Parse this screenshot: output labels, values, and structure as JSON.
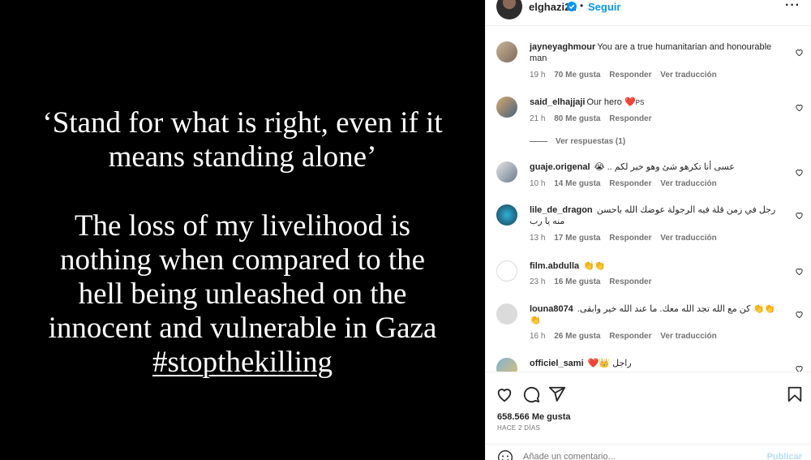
{
  "media": {
    "quote_lines_1": [
      "‘Stand for what is right, even if it",
      "means standing alone’"
    ],
    "quote_lines_2": [
      "The loss of my livelihood is",
      "nothing when compared to the",
      "hell being unleashed on the",
      "innocent and vulnerable in Gaza"
    ],
    "hashtag": "#stopthekilling"
  },
  "header": {
    "username": "elghazi21",
    "separator": "•",
    "follow_label": "Seguir",
    "more_label": "···",
    "verified_color": "#0095f6"
  },
  "comments": [
    {
      "user": "jayneyaghmour",
      "text": "You are a true humanitarian and honourable man",
      "time": "19 h",
      "likes": "70 Me gusta",
      "reply": "Responder",
      "translate": "Ver traducción"
    },
    {
      "user": "said_elhajjaji",
      "text": "Our hero",
      "emoji_suffix": "PS",
      "time": "21 h",
      "likes": "80 Me gusta",
      "reply": "Responder",
      "translate": ""
    },
    {
      "user": "guaje.origenal",
      "text": "عسى أنا تكرهو شئ وهو خير لكم ..",
      "emoji_suffix": "😭",
      "time": "10 h",
      "likes": "14 Me gusta",
      "reply": "Responder",
      "translate": "Ver traducción"
    },
    {
      "user": "lile_de_dragon",
      "text": "رجل في زمن قلة فيه الرجولة عوضك الله باحسن منه يا رب",
      "time": "13 h",
      "likes": "17 Me gusta",
      "reply": "Responder",
      "translate": "Ver traducción"
    },
    {
      "user": "film.abdulla",
      "text": "👏👏",
      "time": "23 h",
      "likes": "16 Me gusta",
      "reply": "Responder",
      "translate": ""
    },
    {
      "user": "louna8074",
      "text": "👏👏 كن مع الله تجد الله معك. ما عند الله خير وابقى. 👏",
      "time": "16 h",
      "likes": "26 Me gusta",
      "reply": "Responder",
      "translate": "Ver traducción"
    },
    {
      "user": "officiel_sami",
      "text": "راجل",
      "emoji_suffix": "❤️👑",
      "time": "",
      "likes": "",
      "reply": "",
      "translate": ""
    }
  ],
  "view_replies_label": "Ver respuestas (1)",
  "actions": {
    "likes_count": "658.566 Me gusta",
    "post_time": "HACE 2 DÍAS",
    "comment_placeholder": "Añade un comentario...",
    "publish_label": "Publicar"
  },
  "colors": {
    "accent": "#0095f6",
    "heart": "#ed4956",
    "muted": "#737373"
  }
}
